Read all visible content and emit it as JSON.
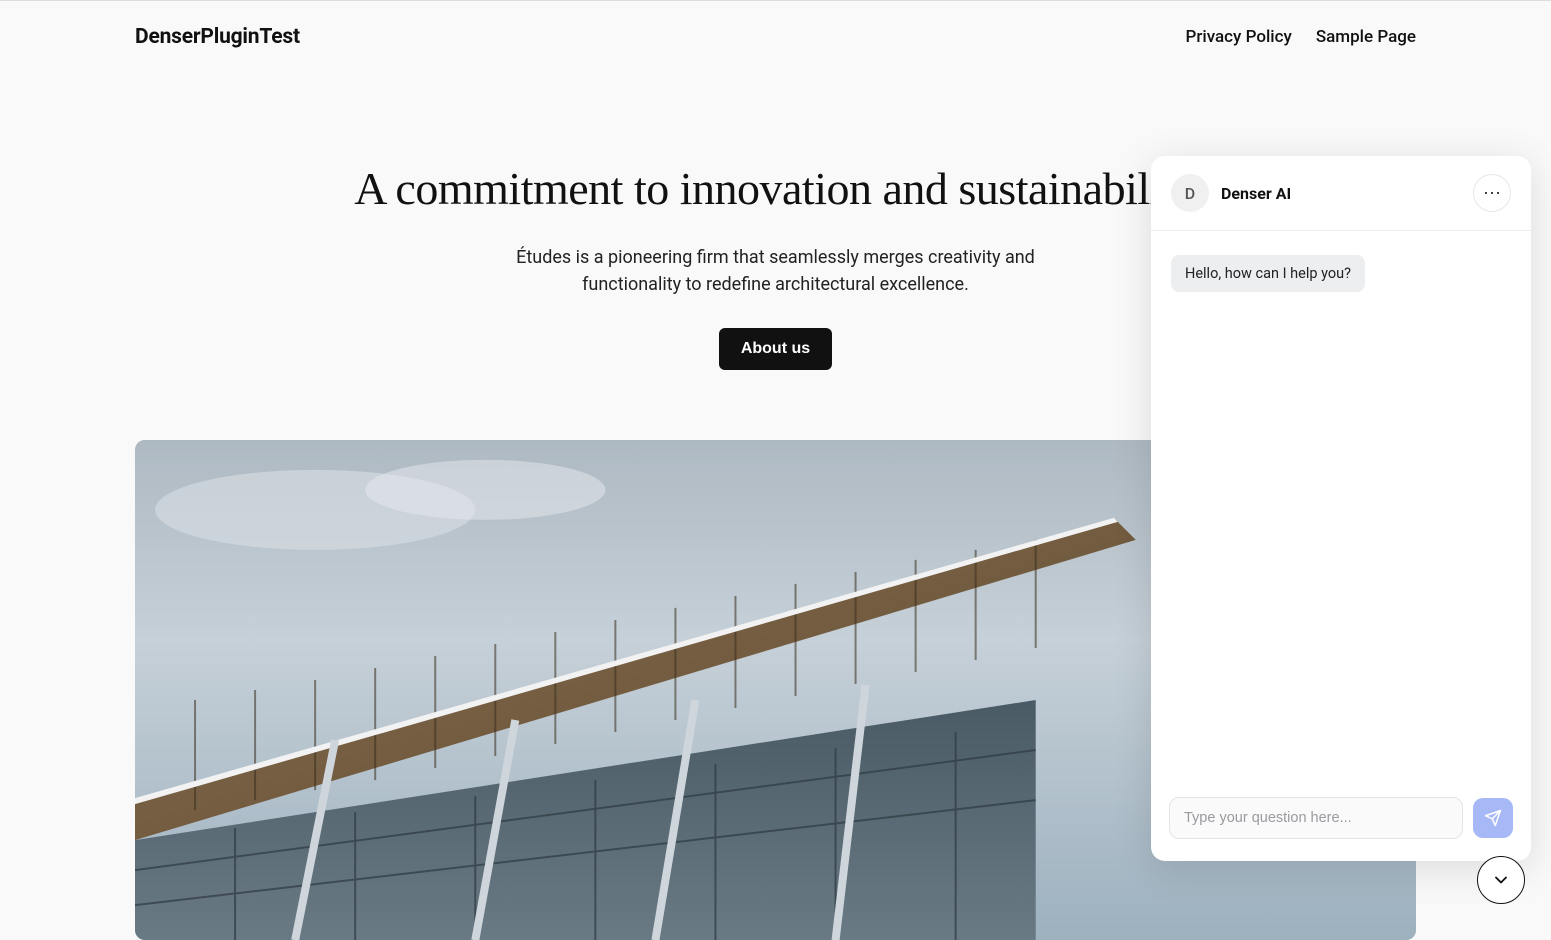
{
  "header": {
    "site_title": "DenserPluginTest",
    "nav": [
      {
        "label": "Privacy Policy"
      },
      {
        "label": "Sample Page"
      }
    ]
  },
  "hero": {
    "heading": "A commitment to innovation and sustainability",
    "subtext": "Études is a pioneering firm that seamlessly merges creativity and functionality to redefine architectural excellence.",
    "cta_label": "About us"
  },
  "chat": {
    "avatar_letter": "D",
    "title": "Denser AI",
    "greeting": "Hello, how can I help you?",
    "input_placeholder": "Type your question here..."
  }
}
